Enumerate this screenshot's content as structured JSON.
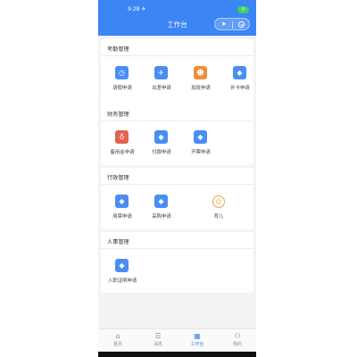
{
  "status": {
    "time": "9:28 ✈",
    "battery": "0"
  },
  "header": {
    "title": "工作台"
  },
  "sections": [
    {
      "title": "考勤管理",
      "items": [
        {
          "label": "请假申请",
          "icon": "calendar-icon",
          "glyph": "◷",
          "color": "#4a8df6"
        },
        {
          "label": "出差申请",
          "icon": "plane-icon",
          "glyph": "✈",
          "color": "#4a8df6"
        },
        {
          "label": "加班申请",
          "icon": "person-icon",
          "glyph": "☻",
          "color": "#ef8d3a"
        },
        {
          "label": "补卡申请",
          "icon": "card-icon",
          "glyph": "◆",
          "color": "#4a8df6"
        }
      ]
    },
    {
      "title": "财务管理",
      "items": [
        {
          "label": "备用金申请",
          "icon": "money-bag-icon",
          "glyph": "♁",
          "color": "#e2624f"
        },
        {
          "label": "付款申请",
          "icon": "payment-icon",
          "glyph": "◆",
          "color": "#4a8df6"
        },
        {
          "label": "开票申请",
          "icon": "invoice-icon",
          "glyph": "◆",
          "color": "#4a8df6"
        }
      ]
    },
    {
      "title": "行政管理",
      "items": [
        {
          "label": "用章申请",
          "icon": "seal-icon",
          "glyph": "◆",
          "color": "#4a8df6"
        },
        {
          "label": "采购申请",
          "icon": "purchase-icon",
          "glyph": "◆",
          "color": "#4a8df6"
        },
        {
          "label": "",
          "icon": "blank-slot",
          "glyph": "",
          "color": ""
        },
        {
          "label": "育儿",
          "icon": "baby-face-icon",
          "glyph": "☺",
          "color": "#f0a344"
        }
      ]
    },
    {
      "title": "人事管理",
      "items": [
        {
          "label": "入职证明申请",
          "icon": "certificate-icon",
          "glyph": "◆",
          "color": "#4a8df6"
        }
      ]
    }
  ],
  "tabs": [
    {
      "label": "首页",
      "icon": "home-icon",
      "glyph": "⌂"
    },
    {
      "label": "消息",
      "icon": "message-icon",
      "glyph": "☰"
    },
    {
      "label": "工作台",
      "icon": "grid-icon",
      "glyph": "▦"
    },
    {
      "label": "我的",
      "icon": "user-icon",
      "glyph": "⚇"
    }
  ]
}
